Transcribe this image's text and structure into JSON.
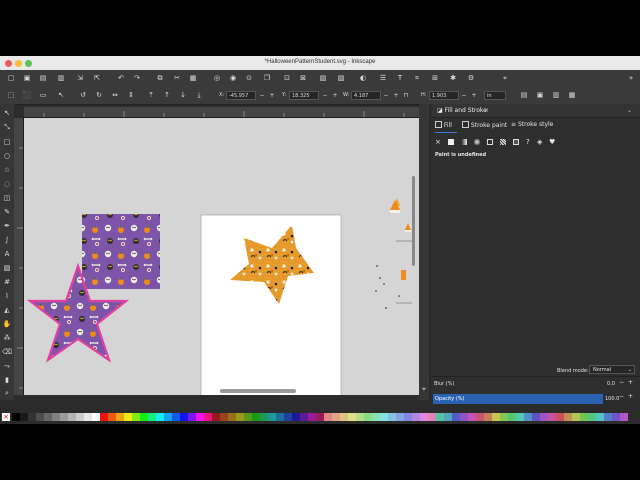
{
  "window": {
    "title": "*HalloweenPatternStudent.svg - Inkscape"
  },
  "toolbar": {
    "x_label": "X:",
    "x_value": "-45.957",
    "y_label": "Y:",
    "y_value": "18.325",
    "w_label": "W:",
    "w_value": "4.187",
    "h_label": "H:",
    "h_value": "1.903",
    "unit": "in"
  },
  "fill_stroke": {
    "panel_title": "Fill and Stroke",
    "tabs": [
      {
        "label": "Fill"
      },
      {
        "label": "Stroke paint"
      },
      {
        "label": "Stroke style"
      }
    ],
    "paint_status": "Paint is undefined",
    "blend_label": "Blend mode:",
    "blend_value": "Normal",
    "blur_label": "Blur (%)",
    "blur_value": "0.0",
    "opacity_label": "Opacity (%)",
    "opacity_value": "100.0"
  },
  "colors": {
    "accent": "#3a7bd5",
    "pattern_purple": "#7c55a8",
    "pattern_orange": "#e69a2b",
    "star_stroke": "#e040a0"
  },
  "icons": [
    "close-icon",
    "new-document-icon",
    "open-icon",
    "save-icon",
    "print-icon",
    "import-icon",
    "export-icon",
    "undo-icon",
    "redo-icon",
    "copy-icon",
    "cut-icon",
    "paste-icon",
    "zoom-icon",
    "text-icon",
    "selector-tool-icon",
    "node-tool-icon",
    "rectangle-tool-icon",
    "ellipse-tool-icon",
    "star-tool-icon",
    "pencil-tool-icon",
    "pen-tool-icon",
    "text-tool-icon",
    "gradient-tool-icon",
    "dropper-tool-icon",
    "bucket-tool-icon",
    "eraser-tool-icon",
    "zoom-tool-icon",
    "lock-icon"
  ]
}
